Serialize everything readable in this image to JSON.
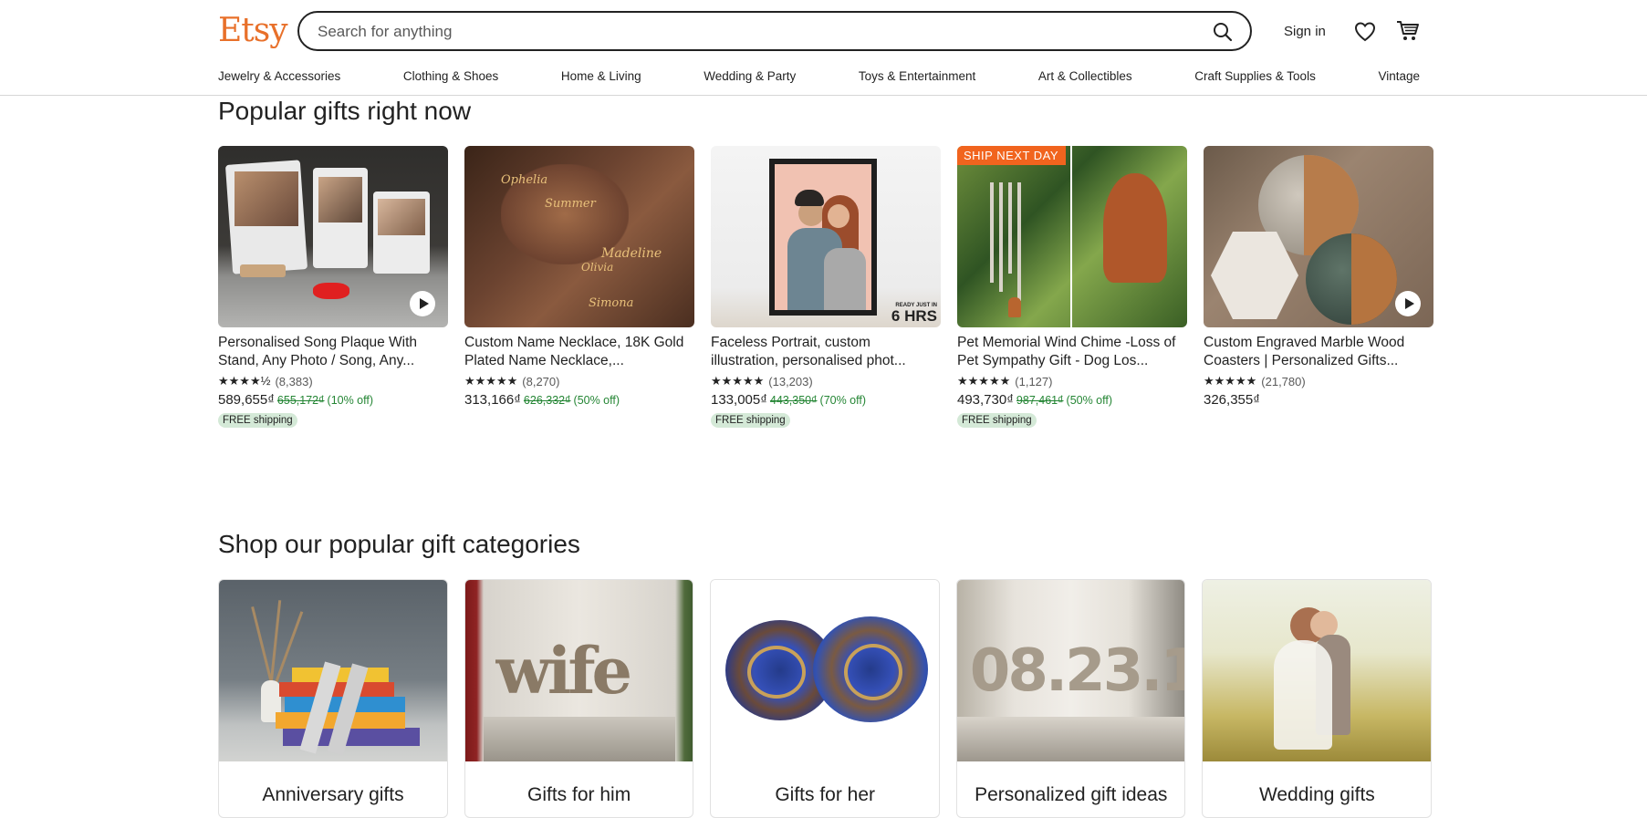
{
  "header": {
    "logo": "Etsy",
    "search_placeholder": "Search for anything",
    "sign_in": "Sign in"
  },
  "nav": [
    "Jewelry & Accessories",
    "Clothing & Shoes",
    "Home & Living",
    "Wedding & Party",
    "Toys & Entertainment",
    "Art & Collectibles",
    "Craft Supplies & Tools",
    "Vintage"
  ],
  "popular": {
    "title": "Popular gifts right now",
    "items": [
      {
        "title": "Personalised Song Plaque With Stand, Any Photo / Song, Any...",
        "stars": "★★★★½",
        "reviews": "(8,383)",
        "price": "589,655₫",
        "old_price": "655,172₫",
        "discount": "(10% off)",
        "free_shipping": "FREE shipping"
      },
      {
        "title": "Custom Name Necklace, 18K Gold Plated Name Necklace,...",
        "stars": "★★★★★",
        "reviews": "(8,270)",
        "price": "313,166₫",
        "old_price": "626,332₫",
        "discount": "(50% off)"
      },
      {
        "title": "Faceless Portrait, custom illustration, personalised phot...",
        "stars": "★★★★★",
        "reviews": "(13,203)",
        "price": "133,005₫",
        "old_price": "443,350₫",
        "discount": "(70% off)",
        "free_shipping": "FREE shipping",
        "badge_small": "READY JUST IN",
        "badge_big": "6 HRS"
      },
      {
        "title": "Pet Memorial Wind Chime -Loss of Pet Sympathy Gift - Dog Los...",
        "stars": "★★★★★",
        "reviews": "(1,127)",
        "price": "493,730₫",
        "old_price": "987,461₫",
        "discount": "(50% off)",
        "free_shipping": "FREE shipping",
        "ship_badge": "SHIP NEXT DAY"
      },
      {
        "title": "Custom Engraved Marble Wood Coasters | Personalized Gifts...",
        "stars": "★★★★★",
        "reviews": "(21,780)",
        "price": "326,355₫"
      }
    ]
  },
  "categories": {
    "title": "Shop our popular gift categories",
    "items": [
      "Anniversary gifts",
      "Gifts for him",
      "Gifts for her",
      "Personalized gift ideas",
      "Wedding gifts"
    ]
  },
  "colors": {
    "brand": "#e8702a",
    "discount": "#258635",
    "ship_badge": "#f1641e"
  }
}
